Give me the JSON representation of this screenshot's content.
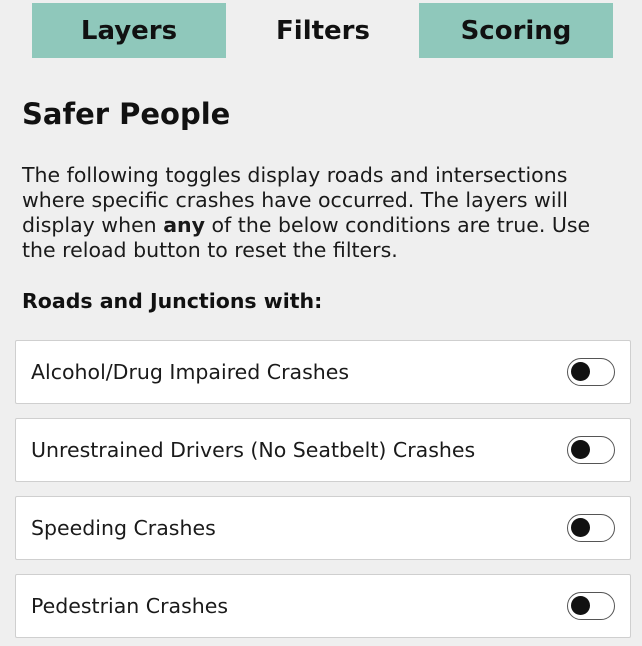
{
  "tabs": [
    {
      "label": "Layers",
      "active": false
    },
    {
      "label": "Filters",
      "active": true
    },
    {
      "label": "Scoring",
      "active": false
    }
  ],
  "colors": {
    "tab_inactive_bg": "#8fc8bb",
    "page_bg": "#efefef",
    "row_bg": "#ffffff",
    "row_border": "#cfcfcf"
  },
  "section": {
    "title": "Safer People",
    "description_part1": "The following toggles display roads and intersections where specific crashes have occurred. The layers will display when ",
    "description_emphasis": "any",
    "description_part2": " of the below conditions are true. Use the reload button to reset the filters.",
    "subheading": "Roads and Junctions with:"
  },
  "filters": [
    {
      "label": "Alcohol/Drug Impaired Crashes",
      "enabled": false
    },
    {
      "label": "Unrestrained Drivers (No Seatbelt) Crashes",
      "enabled": false
    },
    {
      "label": "Speeding Crashes",
      "enabled": false
    },
    {
      "label": "Pedestrian Crashes",
      "enabled": false
    }
  ]
}
